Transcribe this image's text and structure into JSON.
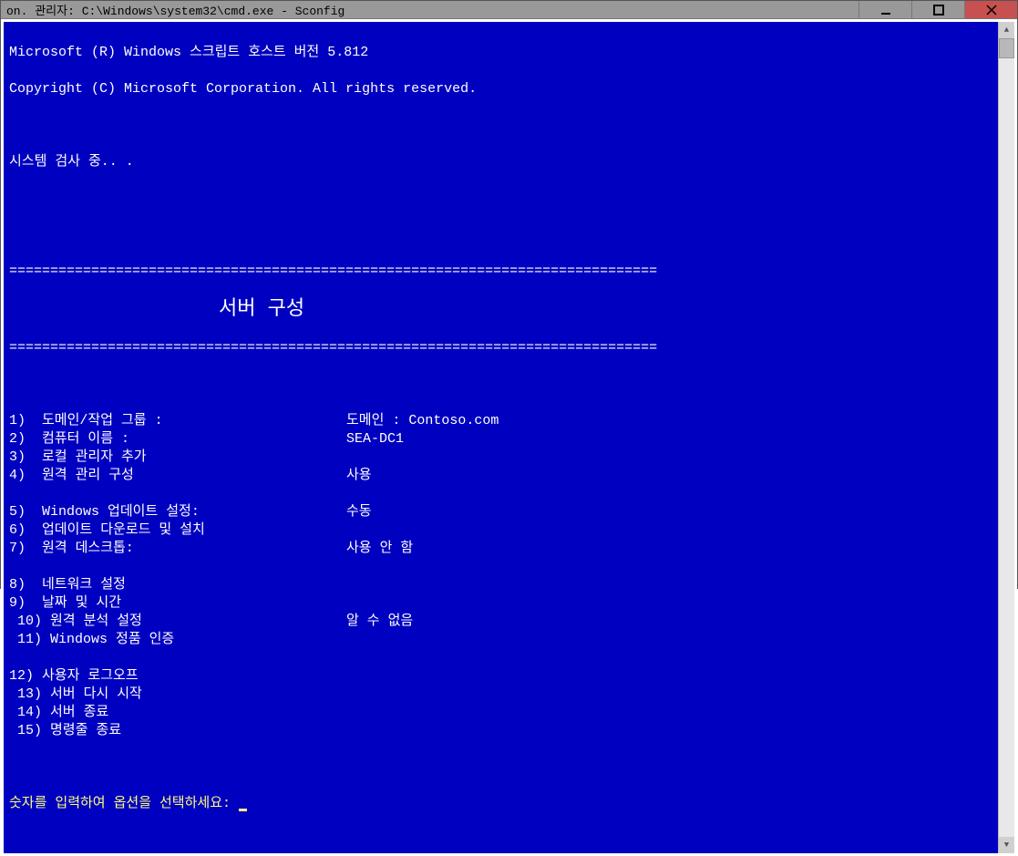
{
  "title": "on. 관리자: C:\\Windows\\system32\\cmd.exe -    Sconfig",
  "header_line1": "Microsoft (R) Windows 스크립트 호스트 버전 5.812",
  "header_line2": "Copyright (C) Microsoft Corporation. All rights reserved.",
  "status": "시스템 검사 중.. .",
  "divider": "===============================================================================",
  "section_title": "서버 구성",
  "menu": [
    {
      "num": "1)",
      "label": "  도메인/작업 그룹 :",
      "value": "도메인 : Contoso.com"
    },
    {
      "num": "2)",
      "label": "  컴퓨터 이름 :",
      "value": "SEA-DC1"
    },
    {
      "num": "3)",
      "label": "  로컬 관리자 추가",
      "value": ""
    },
    {
      "num": "4)",
      "label": "  원격 관리 구성",
      "value": "사용"
    },
    {
      "num": "",
      "label": "",
      "value": ""
    },
    {
      "num": "5)",
      "label": "  Windows 업데이트 설정:",
      "value": "수동"
    },
    {
      "num": "6)",
      "label": "  업데이트 다운로드 및 설치",
      "value": ""
    },
    {
      "num": "7)",
      "label": "  원격 데스크톱:",
      "value": "사용 안 함"
    },
    {
      "num": "",
      "label": "",
      "value": ""
    },
    {
      "num": "8)",
      "label": "  네트워크 설정",
      "value": ""
    },
    {
      "num": "9)",
      "label": "  날짜 및 시간",
      "value": ""
    },
    {
      "num": " 10)",
      "label": " 원격 분석 설정",
      "value": "알 수 없음"
    },
    {
      "num": " 11)",
      "label": " Windows 정품 인증",
      "value": ""
    },
    {
      "num": "",
      "label": "",
      "value": ""
    },
    {
      "num": "12)",
      "label": " 사용자 로그오프",
      "value": ""
    },
    {
      "num": " 13)",
      "label": " 서버 다시 시작",
      "value": ""
    },
    {
      "num": " 14)",
      "label": " 서버 종료",
      "value": ""
    },
    {
      "num": " 15)",
      "label": " 명령줄 종료",
      "value": ""
    }
  ],
  "prompt": "숫자를 입력하여 옵션을 선택하세요:"
}
